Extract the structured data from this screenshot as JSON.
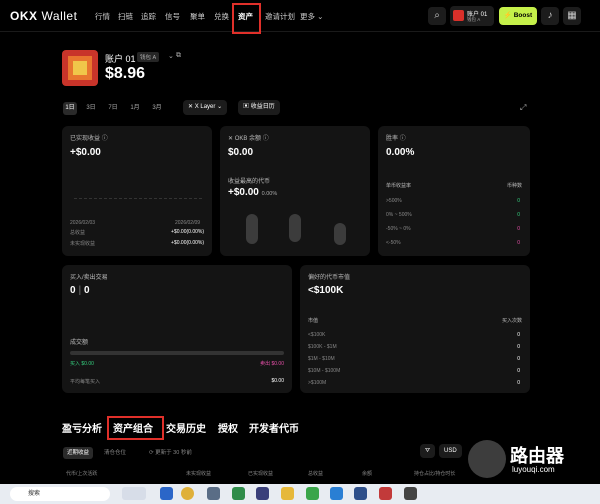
{
  "brand": {
    "logo": "OKX",
    "product": "Wallet"
  },
  "nav": {
    "items": [
      "行情",
      "扫链",
      "追踪",
      "信号",
      "聚单",
      "兑换",
      "资产",
      "邀请计划",
      "更多"
    ],
    "active": "资产"
  },
  "header_account": {
    "name": "账户 01",
    "sub": "钱包 A"
  },
  "boost_label": "Boost",
  "account": {
    "name": "账户 01",
    "tag": "钱包 A",
    "balance": "$8.96"
  },
  "ranges": [
    "1日",
    "3日",
    "7日",
    "1月",
    "3月"
  ],
  "filters": {
    "chain": "X Layer",
    "calendar": "收益日历"
  },
  "pnl_card": {
    "title": "已实现收益",
    "value": "+$0.00",
    "date_start": "2026/02/03",
    "date_end": "2026/02/09",
    "rows": [
      {
        "label": "总收益",
        "value": "+$0.00(0.00%)"
      },
      {
        "label": "未实现收益",
        "value": "+$0.00(0.00%)"
      }
    ]
  },
  "okb_card": {
    "title": "OKB 余额",
    "value": "$0.00",
    "top_title": "收益最高的代币",
    "top_value": "+$0.00",
    "top_pct": "0.00%"
  },
  "winrate_card": {
    "title": "胜率",
    "value": "0.00%",
    "col1": "单币收益率",
    "col2": "币种数",
    "rows": [
      {
        "label": ">500%",
        "count": "0",
        "color": "#35d07f"
      },
      {
        "label": "0% ~ 500%",
        "count": "0",
        "color": "#35d07f"
      },
      {
        "label": "-50% ~ 0%",
        "count": "0",
        "color": "#e64fa8"
      },
      {
        "label": "<-50%",
        "count": "0",
        "color": "#e64fa8"
      }
    ]
  },
  "trades_card": {
    "title": "买入/卖出交易",
    "buy": "0",
    "sell": "0",
    "volume_label": "成交额",
    "buy_label": "买入 $0.00",
    "sell_label": "卖出 $0.00",
    "avg_label": "平均每笔买入",
    "avg_value": "$0.00"
  },
  "mcap_card": {
    "title": "偏好的代币市值",
    "value": "<$100K",
    "col1": "市值",
    "col2": "买入次数",
    "rows": [
      {
        "label": "<$100K",
        "count": "0"
      },
      {
        "label": "$100K - $1M",
        "count": "0"
      },
      {
        "label": "$1M - $10M",
        "count": "0"
      },
      {
        "label": "$10M - $100M",
        "count": "0"
      },
      {
        "label": ">$100M",
        "count": "0"
      }
    ]
  },
  "tabs": [
    "盈亏分析",
    "资产组合",
    "交易历史",
    "授权",
    "开发者代币"
  ],
  "subtabs": {
    "a": "近期收益",
    "b": "清仓仓位",
    "refresh": "更新于 30 秒前"
  },
  "table_headers": [
    "代币/上次活跃",
    "未实现收益",
    "已实现收益",
    "总收益",
    "余额",
    "持仓占比/持仓时长"
  ],
  "usd_label": "USD",
  "taskbar": {
    "search_placeholder": "搜索"
  },
  "watermark": {
    "title": "路由器",
    "sub": "luyouqi.com"
  }
}
